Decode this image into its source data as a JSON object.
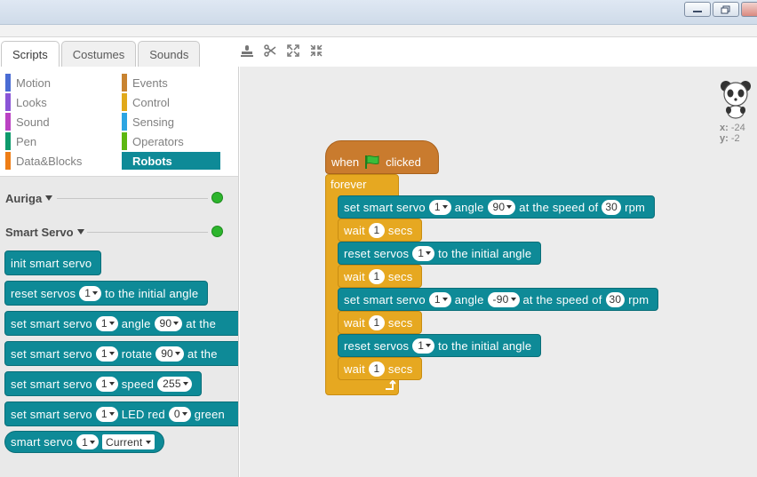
{
  "window": {
    "minimize_label": "▭",
    "restore_label": "⧉"
  },
  "tabs": [
    {
      "label": "Scripts",
      "active": true
    },
    {
      "label": "Costumes",
      "active": false
    },
    {
      "label": "Sounds",
      "active": false
    }
  ],
  "tools": [
    {
      "icon": "stamp-icon"
    },
    {
      "icon": "scissors-icon"
    },
    {
      "icon": "grow-icon"
    },
    {
      "icon": "shrink-icon"
    }
  ],
  "categories": [
    {
      "label": "Motion",
      "color": "#4a6cd4"
    },
    {
      "label": "Looks",
      "color": "#8a55d7"
    },
    {
      "label": "Sound",
      "color": "#bb42c3"
    },
    {
      "label": "Pen",
      "color": "#0e9a6c"
    },
    {
      "label": "Data&Blocks",
      "color": "#ee7d16"
    },
    {
      "label": "Events",
      "color": "#c88330"
    },
    {
      "label": "Control",
      "color": "#e1a91a"
    },
    {
      "label": "Sensing",
      "color": "#2ca5e2"
    },
    {
      "label": "Operators",
      "color": "#5cb712"
    },
    {
      "label": "Robots",
      "color": "#0e8a97"
    }
  ],
  "sections": [
    {
      "label": "Auriga"
    },
    {
      "label": "Smart Servo"
    }
  ],
  "palette_blocks": {
    "init": {
      "text": "init smart servo"
    },
    "reset": {
      "a": "reset servos",
      "port": "1",
      "b": "to the initial angle"
    },
    "angle": {
      "a": "set smart servo",
      "port": "1",
      "b": "angle",
      "val": "90",
      "c": "at the"
    },
    "rotate": {
      "a": "set smart servo",
      "port": "1",
      "b": "rotate",
      "val": "90",
      "c": "at the"
    },
    "speed": {
      "a": "set smart servo",
      "port": "1",
      "b": "speed",
      "val": "255"
    },
    "led": {
      "a": "set smart servo",
      "port": "1",
      "b": "LED red",
      "val": "0",
      "c": "green"
    },
    "reporter": {
      "a": "smart servo",
      "port": "1",
      "option": "Current"
    }
  },
  "script": {
    "hat": {
      "a": "when",
      "b": "clicked"
    },
    "forever": "forever",
    "s1": {
      "a": "set smart servo",
      "port": "1",
      "b": "angle",
      "angle": "90",
      "c": "at the speed of",
      "speed": "30",
      "d": "rpm"
    },
    "w1": {
      "a": "wait",
      "n": "1",
      "b": "secs"
    },
    "r1": {
      "a": "reset servos",
      "port": "1",
      "b": "to the initial angle"
    },
    "w2": {
      "a": "wait",
      "n": "1",
      "b": "secs"
    },
    "s2": {
      "a": "set smart servo",
      "port": "1",
      "b": "angle",
      "angle": "-90",
      "c": "at the speed of",
      "speed": "30",
      "d": "rpm"
    },
    "w3": {
      "a": "wait",
      "n": "1",
      "b": "secs"
    },
    "r2": {
      "a": "reset servos",
      "port": "1",
      "b": "to the initial angle"
    },
    "w4": {
      "a": "wait",
      "n": "1",
      "b": "secs"
    }
  },
  "sprite": {
    "x_label": "x:",
    "x": "-24",
    "y_label": "y:",
    "y": "-2"
  }
}
